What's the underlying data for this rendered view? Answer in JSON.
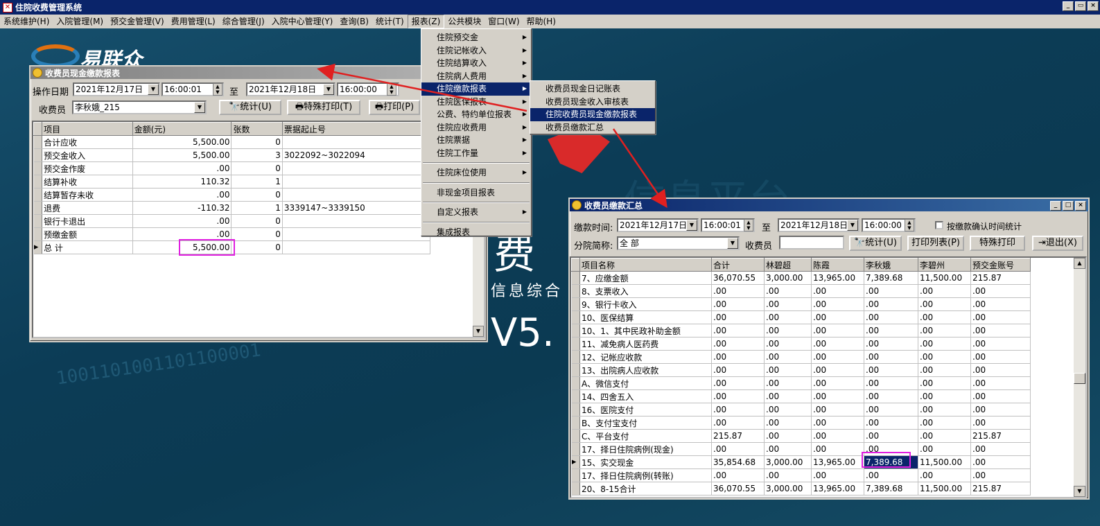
{
  "app": {
    "title": "住院收费管理系统"
  },
  "menubar": [
    "系统维护(H)",
    "入院管理(M)",
    "预交金管理(V)",
    "费用管理(L)",
    "综合管理(J)",
    "入院中心管理(Y)",
    "查询(B)",
    "统计(T)",
    "报表(Z)",
    "公共模块",
    "窗口(W)",
    "帮助(H)"
  ],
  "report_menu": [
    "住院预交金",
    "住院记帐收入",
    "住院结算收入",
    "住院病人费用",
    "住院缴款报表",
    "住院医保报表",
    "公费、特约单位报表",
    "住院应收费用",
    "住院票据",
    "住院工作量",
    "住院床位使用",
    "非现金项目报表",
    "自定义报表",
    "集成报表"
  ],
  "submenu": [
    "收费员现金日记账表",
    "收费员现金收入审核表",
    "住院收费员现金缴款报表",
    "收费员缴款汇总"
  ],
  "background": {
    "logo": "易联众",
    "big1": "费",
    "big2": "信息综合",
    "big3": "V5."
  },
  "win1": {
    "title": "收费员现金缴款报表",
    "date_label": "操作日期",
    "date_from": "2021年12月17日",
    "time_from": "16:00:01",
    "to": "至",
    "date_to": "2021年12月18日",
    "time_to": "16:00:00",
    "cashier_label": "收费员",
    "cashier": "李秋娥_215",
    "btn_stat": "统计(U)",
    "btn_special": "特殊打印(T)",
    "btn_print": "打印(P)",
    "columns": [
      "项目",
      "金额(元)",
      "张数",
      "票据起止号"
    ],
    "rows": [
      [
        "  合计应收",
        "5,500.00",
        "0",
        ""
      ],
      [
        "预交金收入",
        "5,500.00",
        "3",
        "3022092~3022094"
      ],
      [
        "预交金作废",
        ".00",
        "0",
        ""
      ],
      [
        "结算补收",
        "110.32",
        "1",
        ""
      ],
      [
        "结算暂存未收",
        ".00",
        "0",
        ""
      ],
      [
        "退费",
        "-110.32",
        "1",
        "3339147~3339150"
      ],
      [
        "银行卡退出",
        ".00",
        "0",
        ""
      ],
      [
        "预缴金额",
        ".00",
        "0",
        ""
      ],
      [
        "  总  计",
        "5,500.00",
        "0",
        ""
      ]
    ]
  },
  "win2": {
    "title": "收费员缴款汇总",
    "time_label": "缴款时间:",
    "date_from": "2021年12月17日",
    "time_from": "16:00:01",
    "to": "至",
    "date_to": "2021年12月18日",
    "time_to": "16:00:00",
    "chk_label": "按缴款确认时间统计",
    "branch_label": "分院简称:",
    "branch": "全 部",
    "cashier_label": "收费员",
    "btn_stat": "统计(U)",
    "btn_list": "打印列表(P)",
    "btn_special": "特殊打印",
    "btn_exit": "退出(X)",
    "columns": [
      "项目名称",
      "合计",
      "林碧超",
      "陈霞",
      "李秋娥",
      "李碧州",
      "预交金账号"
    ],
    "rows": [
      [
        "7、应缴金额",
        "36,070.55",
        "3,000.00",
        "13,965.00",
        "7,389.68",
        "11,500.00",
        "215.87"
      ],
      [
        "8、支票收入",
        ".00",
        ".00",
        ".00",
        ".00",
        ".00",
        ".00"
      ],
      [
        "9、银行卡收入",
        ".00",
        ".00",
        ".00",
        ".00",
        ".00",
        ".00"
      ],
      [
        "10、医保结算",
        ".00",
        ".00",
        ".00",
        ".00",
        ".00",
        ".00"
      ],
      [
        "10、1、其中民政补助金额",
        ".00",
        ".00",
        ".00",
        ".00",
        ".00",
        ".00"
      ],
      [
        "11、减免病人医药费",
        ".00",
        ".00",
        ".00",
        ".00",
        ".00",
        ".00"
      ],
      [
        "12、记帐应收款",
        ".00",
        ".00",
        ".00",
        ".00",
        ".00",
        ".00"
      ],
      [
        "13、出院病人应收款",
        ".00",
        ".00",
        ".00",
        ".00",
        ".00",
        ".00"
      ],
      [
        "A、微信支付",
        ".00",
        ".00",
        ".00",
        ".00",
        ".00",
        ".00"
      ],
      [
        "14、四舍五入",
        ".00",
        ".00",
        ".00",
        ".00",
        ".00",
        ".00"
      ],
      [
        "16、医院支付",
        ".00",
        ".00",
        ".00",
        ".00",
        ".00",
        ".00"
      ],
      [
        "B、支付宝支付",
        ".00",
        ".00",
        ".00",
        ".00",
        ".00",
        ".00"
      ],
      [
        "C、平台支付",
        "215.87",
        ".00",
        ".00",
        ".00",
        ".00",
        "215.87"
      ],
      [
        "17、择日住院病例(现金)",
        ".00",
        ".00",
        ".00",
        ".00",
        ".00",
        ".00"
      ],
      [
        "15、实交现金",
        "35,854.68",
        "3,000.00",
        "13,965.00",
        "7,389.68",
        "11,500.00",
        ".00"
      ],
      [
        "17、择日住院病例(转账)",
        ".00",
        ".00",
        ".00",
        ".00",
        ".00",
        ".00"
      ],
      [
        "20、8-15合计",
        "36,070.55",
        "3,000.00",
        "13,965.00",
        "7,389.68",
        "11,500.00",
        "215.87"
      ]
    ]
  }
}
